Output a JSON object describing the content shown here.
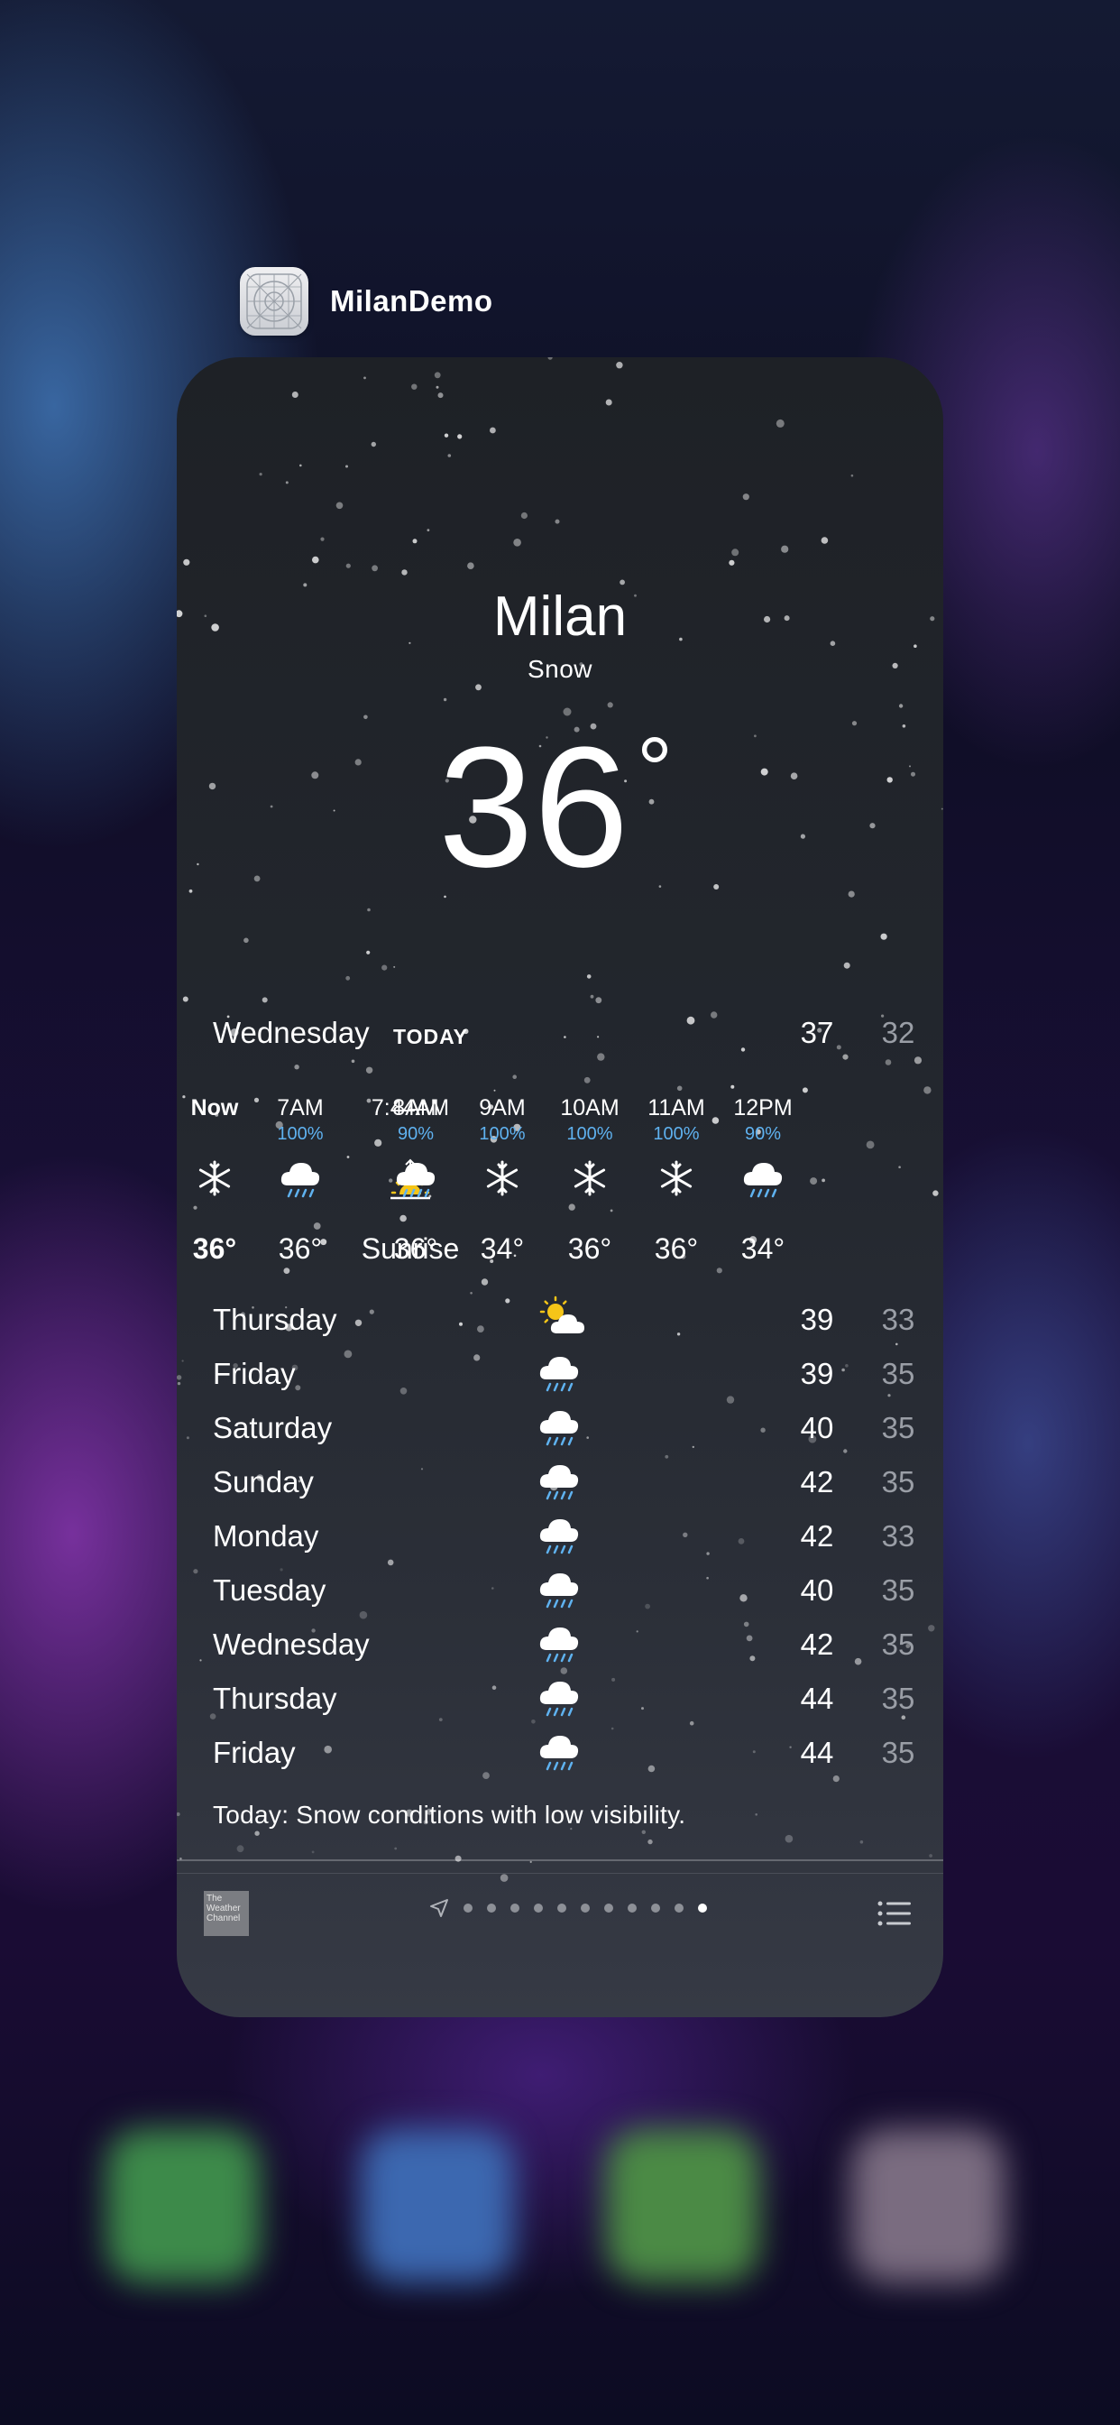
{
  "app": {
    "name": "MilanDemo"
  },
  "weather": {
    "city": "Milan",
    "condition": "Snow",
    "temperature": "36",
    "degree_symbol": "°",
    "today": {
      "day": "Wednesday",
      "label": "TODAY",
      "high": "37",
      "low": "32"
    },
    "hourly": [
      {
        "time": "Now",
        "precip": "",
        "icon": "snowflake-icon",
        "temp": "36°"
      },
      {
        "time": "7AM",
        "precip": "100%",
        "icon": "rain-cloud-icon",
        "temp": "36°"
      },
      {
        "time": "7:44AM",
        "precip": "",
        "icon": "sunrise-icon",
        "temp": "Sunrise"
      },
      {
        "time": "8AM",
        "precip": "90%",
        "icon": "rain-cloud-icon",
        "temp": "36°"
      },
      {
        "time": "9AM",
        "precip": "100%",
        "icon": "snowflake-icon",
        "temp": "34°"
      },
      {
        "time": "10AM",
        "precip": "100%",
        "icon": "snowflake-icon",
        "temp": "36°"
      },
      {
        "time": "11AM",
        "precip": "100%",
        "icon": "snowflake-icon",
        "temp": "36°"
      },
      {
        "time": "12PM",
        "precip": "90%",
        "icon": "rain-cloud-icon",
        "temp": "34°"
      }
    ],
    "daily": [
      {
        "day": "Thursday",
        "icon": "partly-cloudy-icon",
        "high": "39",
        "low": "33"
      },
      {
        "day": "Friday",
        "icon": "rain-cloud-icon",
        "high": "39",
        "low": "35"
      },
      {
        "day": "Saturday",
        "icon": "rain-cloud-icon",
        "high": "40",
        "low": "35"
      },
      {
        "day": "Sunday",
        "icon": "rain-cloud-icon",
        "high": "42",
        "low": "35"
      },
      {
        "day": "Monday",
        "icon": "rain-cloud-icon",
        "high": "42",
        "low": "33"
      },
      {
        "day": "Tuesday",
        "icon": "rain-cloud-icon",
        "high": "40",
        "low": "35"
      },
      {
        "day": "Wednesday",
        "icon": "rain-cloud-icon",
        "high": "42",
        "low": "35"
      },
      {
        "day": "Thursday",
        "icon": "rain-cloud-icon",
        "high": "44",
        "low": "35"
      },
      {
        "day": "Friday",
        "icon": "rain-cloud-icon",
        "high": "44",
        "low": "35"
      }
    ],
    "summary": "Today: Snow conditions with low visibility."
  },
  "toolbar": {
    "provider_logo_text": "The Weather Channel",
    "page_count": 11,
    "active_page": 11,
    "icons": [
      "location-arrow-icon",
      "list-icon"
    ]
  },
  "colors": {
    "precip": "#5fb2f0",
    "low_temp": "#9a9ea6",
    "sun": "#f5c518"
  }
}
